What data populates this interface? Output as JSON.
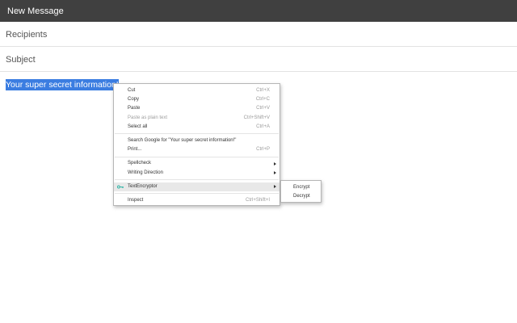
{
  "window": {
    "title": "New Message"
  },
  "compose": {
    "recipients_placeholder": "Recipients",
    "subject_placeholder": "Subject",
    "body_selected_text": "Your super secret information!"
  },
  "context_menu": {
    "items": [
      {
        "label": "Cut",
        "shortcut": "Ctrl+X"
      },
      {
        "label": "Copy",
        "shortcut": "Ctrl+C"
      },
      {
        "label": "Paste",
        "shortcut": "Ctrl+V"
      },
      {
        "label": "Paste as plain text",
        "shortcut": "Ctrl+Shift+V",
        "disabled": true
      },
      {
        "label": "Select all",
        "shortcut": "Ctrl+A"
      },
      {
        "label": "Search Google for \"Your super secret information!\""
      },
      {
        "label": "Print...",
        "shortcut": "Ctrl+P"
      },
      {
        "label": "Spellcheck",
        "submenu": true
      },
      {
        "label": "Writing Direction",
        "submenu": true
      },
      {
        "label": "TextEncryptor",
        "submenu": true,
        "icon": "key-icon",
        "active": true
      },
      {
        "label": "Inspect",
        "shortcut": "Ctrl+Shift+I"
      }
    ]
  },
  "submenu": {
    "items": [
      {
        "label": "Encrypt"
      },
      {
        "label": "Decrypt"
      }
    ]
  },
  "colors": {
    "titlebar": "#404040",
    "selection": "#3b7de1",
    "key_icon": "#2bb3a4"
  }
}
